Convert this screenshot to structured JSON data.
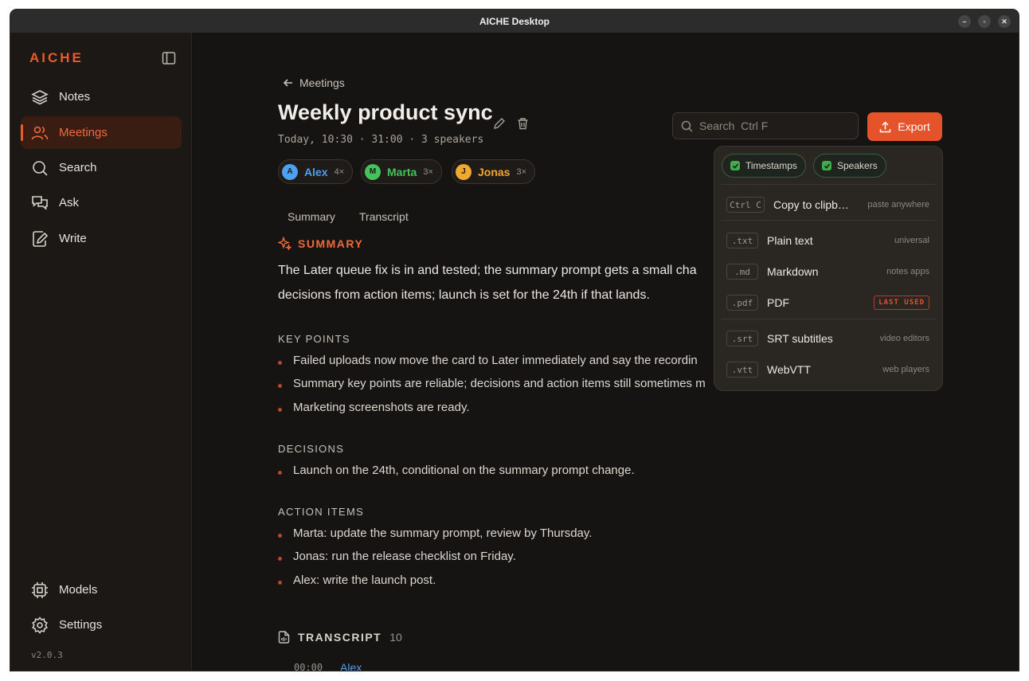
{
  "window": {
    "title": "AICHE Desktop"
  },
  "sidebar": {
    "logo": "AICHE",
    "items": [
      {
        "label": "Notes",
        "icon": "layers-icon"
      },
      {
        "label": "Meetings",
        "icon": "users-icon",
        "active": true
      },
      {
        "label": "Search",
        "icon": "search-icon"
      },
      {
        "label": "Ask",
        "icon": "chat-icon"
      },
      {
        "label": "Write",
        "icon": "edit-doc-icon"
      }
    ],
    "bottom_items": [
      {
        "label": "Models",
        "icon": "chip-icon"
      },
      {
        "label": "Settings",
        "icon": "gear-icon"
      }
    ],
    "version": "v2.0.3"
  },
  "meeting": {
    "breadcrumb": "Meetings",
    "title": "Weekly product sync",
    "meta": "Today, 10:30 · 31:00 · 3 speakers",
    "speakers": [
      {
        "initial": "A",
        "name": "Alex",
        "count": "4×",
        "color": "#4ea0f0"
      },
      {
        "initial": "M",
        "name": "Marta",
        "count": "3×",
        "color": "#46c25a"
      },
      {
        "initial": "J",
        "name": "Jonas",
        "count": "3×",
        "color": "#f0a830"
      }
    ],
    "tabs": [
      "Summary",
      "Transcript"
    ]
  },
  "summary": {
    "heading": "SUMMARY",
    "text": "The Later queue fix is in and tested; the summary prompt gets a small cha decisions from action items; launch is set for the 24th if that lands.",
    "line1": "The Later queue fix is in and tested; the summary prompt gets a small cha",
    "line2": "decisions from action items; launch is set for the 24th if that lands.",
    "key_points_label": "KEY POINTS",
    "key_points": [
      "Failed uploads now move the card to Later immediately and say the recordin",
      "Summary key points are reliable; decisions and action items still sometimes m",
      "Marketing screenshots are ready."
    ],
    "decisions_label": "DECISIONS",
    "decisions": [
      "Launch on the 24th, conditional on the summary prompt change."
    ],
    "action_items_label": "ACTION ITEMS",
    "action_items": [
      "Marta: update the summary prompt, review by Thursday.",
      "Jonas: run the release checklist on Friday.",
      "Alex: write the launch post."
    ]
  },
  "transcript": {
    "heading": "TRANSCRIPT",
    "count": "10",
    "first_time": "00:00",
    "first_speaker": "Alex"
  },
  "toolbar": {
    "search_placeholder": "Search  Ctrl F",
    "export_label": "Export"
  },
  "export_menu": {
    "toggles": [
      "Timestamps",
      "Speakers"
    ],
    "copy": {
      "key": "Ctrl C",
      "label": "Copy to clipb…",
      "hint": "paste anywhere"
    },
    "formats": [
      {
        "ext": ".txt",
        "label": "Plain text",
        "hint": "universal"
      },
      {
        "ext": ".md",
        "label": "Markdown",
        "hint": "notes apps"
      },
      {
        "ext": ".pdf",
        "label": "PDF",
        "badge": "LAST USED"
      },
      {
        "ext": ".srt",
        "label": "SRT subtitles",
        "hint": "video editors"
      },
      {
        "ext": ".vtt",
        "label": "WebVTT",
        "hint": "web players"
      }
    ]
  },
  "colors": {
    "accent": "#e5532a",
    "background": "#161412"
  }
}
